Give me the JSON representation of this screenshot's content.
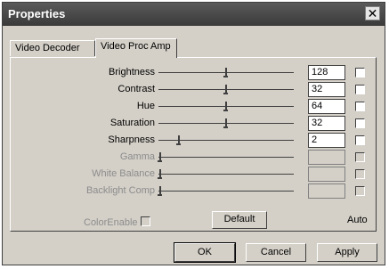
{
  "window": {
    "title": "Properties",
    "close_glyph": "✕"
  },
  "tabs": [
    {
      "label": "Video Decoder",
      "active": false
    },
    {
      "label": "Video Proc Amp",
      "active": true
    }
  ],
  "controls": [
    {
      "label": "Brightness",
      "value": "128",
      "level": 0.5,
      "enabled": true
    },
    {
      "label": "Contrast",
      "value": "32",
      "level": 0.5,
      "enabled": true
    },
    {
      "label": "Hue",
      "value": "64",
      "level": 0.5,
      "enabled": true
    },
    {
      "label": "Saturation",
      "value": "32",
      "level": 0.5,
      "enabled": true
    },
    {
      "label": "Sharpness",
      "value": "2",
      "level": 0.14,
      "enabled": true
    },
    {
      "label": "Gamma",
      "value": "",
      "level": 0.0,
      "enabled": false
    },
    {
      "label": "White Balance",
      "value": "",
      "level": 0.0,
      "enabled": false
    },
    {
      "label": "Backlight Comp",
      "value": "",
      "level": 0.0,
      "enabled": false
    }
  ],
  "color_enable_label": "ColorEnable",
  "default_label": "Default",
  "auto_label": "Auto",
  "buttons": {
    "ok": "OK",
    "cancel": "Cancel",
    "apply": "Apply"
  }
}
